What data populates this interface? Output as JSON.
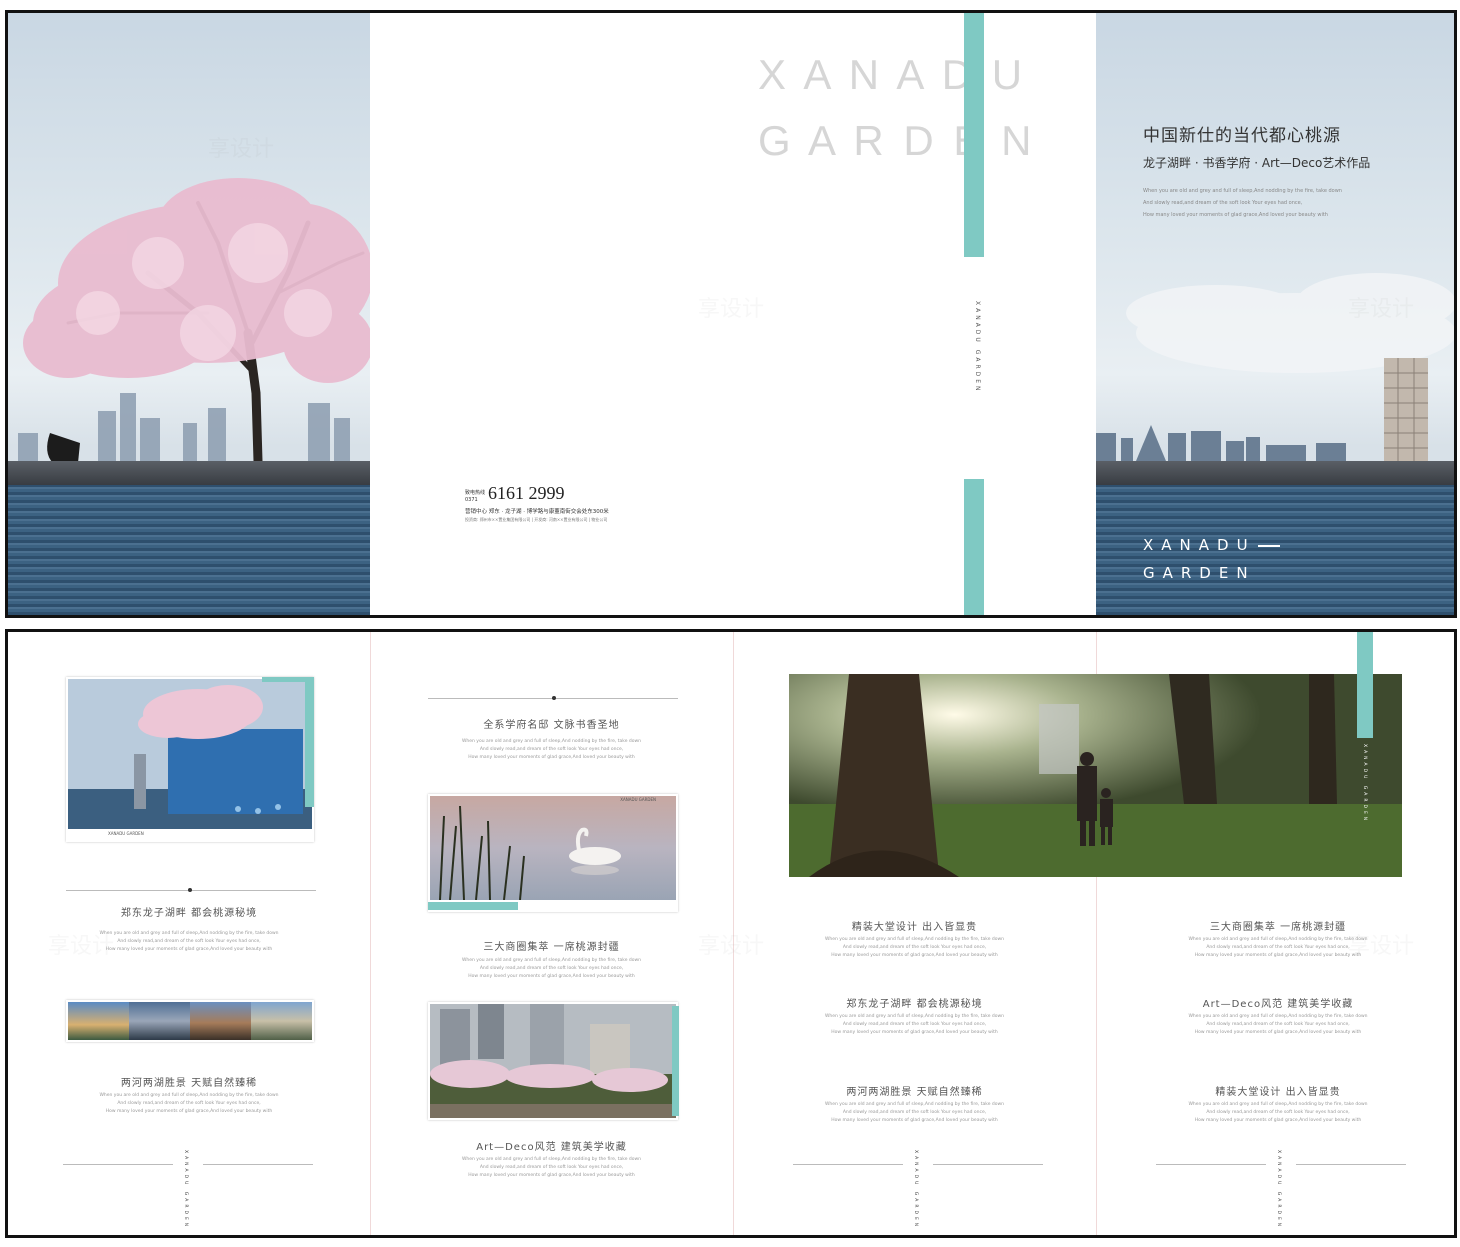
{
  "outside": {
    "center": {
      "xanadu_big": "X A N A D U",
      "garden_big": "G A R D E N",
      "vertical_brand": "XANADU GARDEN",
      "hotline_label": "致电热线",
      "area_code": "0371",
      "phone": "6161 2999",
      "address": "营销中心  郑东 · 龙子湖 · 博学路与康董南街交会处东300米",
      "fine_print": "投资商: 郑州市××置业集团有限公司 | 开发商: 河南××置业有限公司 | 物业公司"
    },
    "right": {
      "headline": "中国新仕的当代都心桃源",
      "subheadline": "龙子湖畔 · 书香学府 · Art—Deco艺术作品",
      "en_lines": [
        "When you are old and grey and full of sleep,And nodding by the fire,  take down",
        "And slowly read,and dream of the soft look Your eyes had once,",
        "How many loved your moments of glad grace,And loved your beauty with"
      ],
      "brand_line1": "XANADU",
      "brand_line2": "GARDEN"
    }
  },
  "inside": {
    "p1": {
      "caption_small": "XANADU GARDEN",
      "block1_title": "郑东龙子湖畔  都会桃源秘境",
      "block2_title": "两河两湖胜景  天赋自然臻稀",
      "signature": "XANADU GARDEN"
    },
    "p2": {
      "block1_title": "全系学府名邸  文脉书香圣地",
      "photo_caption": "XANADU GARDEN",
      "block2_title": "三大商圈集萃  一席桃源封疆",
      "block3_title": "Art—Deco风范  建筑美学收藏"
    },
    "p3": {
      "photo_vertical": "XANADU GARDEN",
      "block1_title": "精装大堂设计  出入皆显贵",
      "block2_title": "郑东龙子湖畔  都会桃源秘境",
      "block3_title": "两河两湖胜景  天赋自然臻稀",
      "signature": "XANADU GARDEN"
    },
    "p4": {
      "block1_title": "三大商圈集萃  一席桃源封疆",
      "block2_title": "Art—Deco风范  建筑美学收藏",
      "block3_title": "精装大堂设计  出入皆显贵",
      "signature": "XANADU GARDEN"
    }
  },
  "body_en": {
    "line1": "When you are old and grey and full of sleep,And nodding by the fire,  take down",
    "line2": "And slowly read,and dream of the soft look Your eyes had once,",
    "line3": "How many loved your moments of glad grace,And loved your beauty with"
  },
  "watermark": "享设计",
  "colors": {
    "accent_teal": "#7fc9c3",
    "water": "#3c6282",
    "blossom": "#e9bcd0"
  }
}
